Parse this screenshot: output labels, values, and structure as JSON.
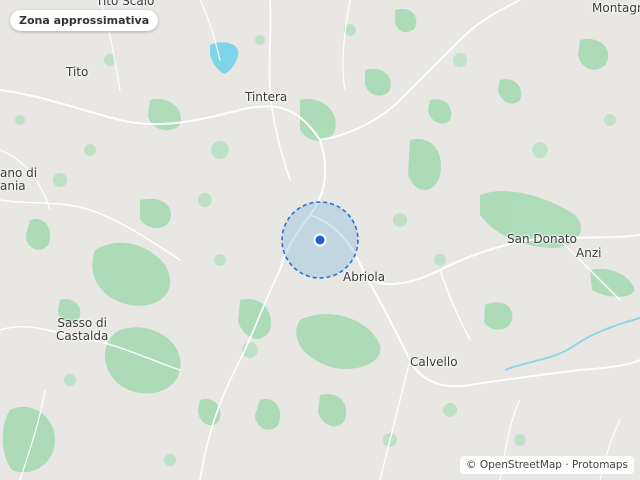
{
  "badge": {
    "label": "Zona approssimativa"
  },
  "attribution": {
    "osm": "© OpenStreetMap",
    "sep": " · ",
    "protomaps": "Protomaps"
  },
  "places": {
    "tito_scalo": "Tito Scalo",
    "montagn": "Montagn",
    "tito": "Tito",
    "tintera": "Tintera",
    "ano_di": "ano di",
    "ania": "ania",
    "san_donato": "San Donato",
    "anzi": "Anzi",
    "abriola": "Abriola",
    "sasso_line1": "Sasso di",
    "sasso_line2": "Castalda",
    "calvello": "Calvello"
  },
  "colors": {
    "background": "#e9e7e3",
    "forest": "#93d3a8",
    "water": "#7fd4ea",
    "road": "#ffffff",
    "accuracy_fill": "#7ab7df",
    "accuracy_stroke": "#2d6fd0",
    "marker": "#1f5fd1"
  }
}
